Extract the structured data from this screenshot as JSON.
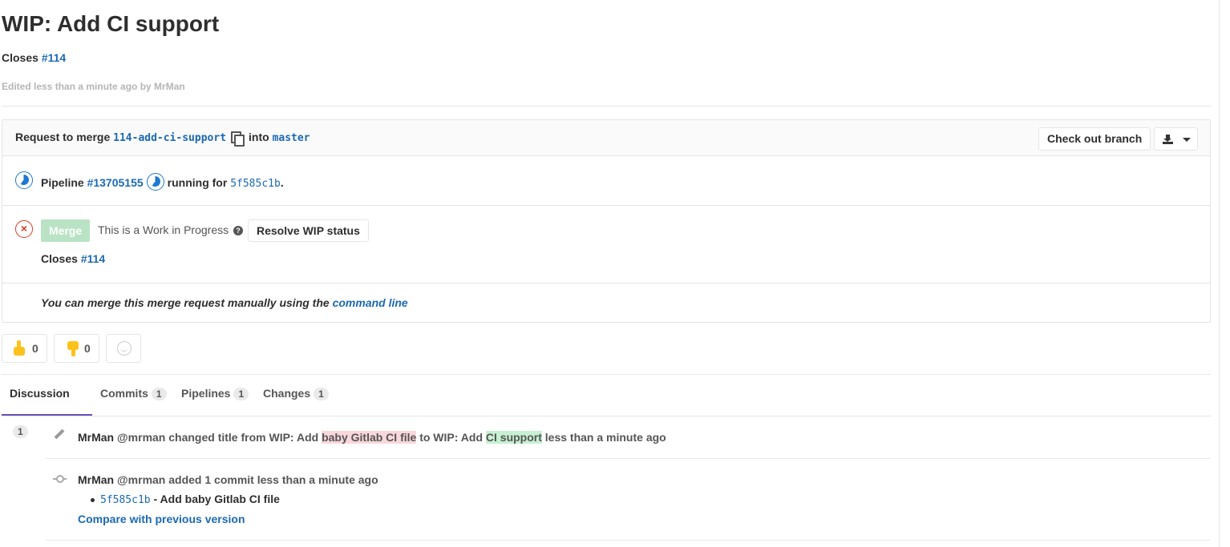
{
  "mr": {
    "title": "WIP: Add CI support",
    "description_prefix": "Closes ",
    "description_issue": "#114",
    "edited": "Edited less than a minute ago by MrMan"
  },
  "widget": {
    "request_prefix": "Request to merge ",
    "source_branch": "114-add-ci-support",
    "into": "into ",
    "target_branch": "master",
    "checkout_label": "Check out branch",
    "pipeline_label": "Pipeline ",
    "pipeline_id": "#13705155",
    "pipeline_status": "running for ",
    "commit_sha": "5f585c1b",
    "period": ".",
    "merge_label": "Merge",
    "wip_text": "This is a Work in Progress",
    "resolve_label": "Resolve WIP status",
    "closes_prefix": "Closes ",
    "closes_issue": "#114",
    "cmd_prefix": "You can merge this merge request manually using the ",
    "cmd_link": "command line"
  },
  "awards": {
    "thumbsup": "0",
    "thumbsdown": "0"
  },
  "tabs": [
    {
      "label": "Discussion",
      "count": "1"
    },
    {
      "label": "Commits",
      "count": "1"
    },
    {
      "label": "Pipelines",
      "count": "1"
    },
    {
      "label": "Changes",
      "count": "1"
    }
  ],
  "notes": [
    {
      "author": "MrMan",
      "handle": "@mrman",
      "text_a": " changed title from WIP: Add ",
      "removed": "baby Gitlab CI file",
      "text_b": " to WIP: Add ",
      "added": "CI support",
      "time": " less than a minute ago"
    },
    {
      "author": "MrMan",
      "handle": "@mrman",
      "text": " added 1 commit less than a minute ago",
      "commit_sha": "5f585c1b",
      "commit_msg": " - Add baby Gitlab CI file",
      "compare": "Compare with previous version"
    }
  ],
  "colors": {
    "link": "#1b69b6",
    "merge_disabled": "#b9e3c4",
    "running": "#1f78d1",
    "failed": "#db3b21",
    "tab_active": "#6b4fbb"
  }
}
